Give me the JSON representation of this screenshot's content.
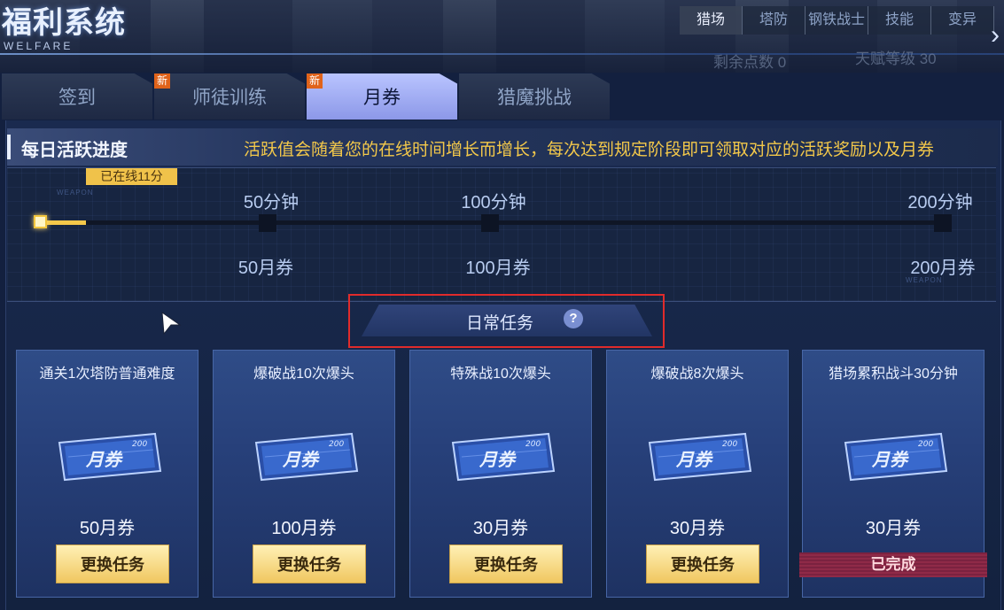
{
  "window": {
    "title": "福利系统",
    "subtitle": "WELFARE"
  },
  "top_tabs": {
    "items": [
      {
        "label": "猎场",
        "active": true
      },
      {
        "label": "塔防",
        "active": false
      },
      {
        "label": "钢铁战士",
        "active": false
      },
      {
        "label": "技能",
        "active": false
      },
      {
        "label": "变异",
        "active": false
      }
    ],
    "remaining_points": "剩余点数 0",
    "talent_level": "天赋等级 30"
  },
  "tabs": [
    {
      "label": "签到",
      "new": false,
      "active": false
    },
    {
      "label": "师徒训练",
      "new": true,
      "active": false
    },
    {
      "label": "月券",
      "new": true,
      "active": true
    },
    {
      "label": "猎魔挑战",
      "new": false,
      "active": false
    }
  ],
  "new_badge_text": "新",
  "progress": {
    "title": "每日活跃进度",
    "description": "活跃值会随着您的在线时间增长而增长，每次达到规定阶段即可领取对应的活跃奖励以及月券",
    "online_badge": "已在线11分",
    "online_minutes": 11,
    "max_minutes": 200,
    "deco_text": "WEAPON",
    "milestones": [
      {
        "time": "50分钟",
        "reward": "50月券",
        "minutes": 50
      },
      {
        "time": "100分钟",
        "reward": "100月券",
        "minutes": 100
      },
      {
        "time": "200分钟",
        "reward": "200月券",
        "minutes": 200
      }
    ]
  },
  "daily_tasks": {
    "title": "日常任务",
    "help_symbol": "?",
    "cards": [
      {
        "title": "通关1次塔防普通难度",
        "reward": "50月券",
        "button": "更换任务",
        "done": false
      },
      {
        "title": "爆破战10次爆头",
        "reward": "100月券",
        "button": "更换任务",
        "done": false
      },
      {
        "title": "特殊战10次爆头",
        "reward": "30月券",
        "button": "更换任务",
        "done": false
      },
      {
        "title": "爆破战8次爆头",
        "reward": "30月券",
        "button": "更换任务",
        "done": false
      },
      {
        "title": "猎场累积战斗30分钟",
        "reward": "30月券",
        "button": "已完成",
        "done": true
      }
    ],
    "ticket_text": "月券",
    "ticket_value": "200"
  },
  "colors": {
    "accent_gold": "#f3c84a",
    "active_tab": "#a9b4f6",
    "done_red": "#8f2a48",
    "highlight_border": "#e02b2b"
  }
}
